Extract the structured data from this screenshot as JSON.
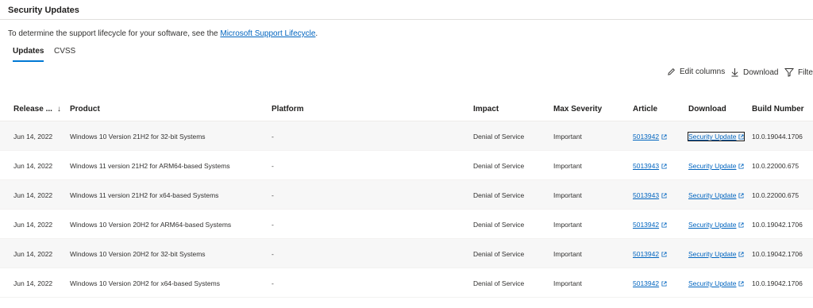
{
  "header": {
    "title": "Security Updates"
  },
  "intro": {
    "text": "To determine the support lifecycle for your software, see the ",
    "link": "Microsoft Support Lifecycle",
    "suffix": "."
  },
  "tabs": [
    {
      "label": "Updates",
      "active": true
    },
    {
      "label": "CVSS",
      "active": false
    }
  ],
  "toolbar": {
    "edit_columns": "Edit columns",
    "download": "Download",
    "filter": "Filter"
  },
  "columns": {
    "release": "Release ...",
    "product": "Product",
    "platform": "Platform",
    "impact": "Impact",
    "max_severity": "Max Severity",
    "article": "Article",
    "download": "Download",
    "build_number": "Build Number"
  },
  "rows": [
    {
      "date": "Jun 14, 2022",
      "product": "Windows 10 Version 21H2 for 32-bit Systems",
      "platform": "-",
      "impact": "Denial of Service",
      "severity": "Important",
      "article": "5013942",
      "download": "Security Update",
      "build": "10.0.19044.1706"
    },
    {
      "date": "Jun 14, 2022",
      "product": "Windows 11 version 21H2 for ARM64-based Systems",
      "platform": "-",
      "impact": "Denial of Service",
      "severity": "Important",
      "article": "5013943",
      "download": "Security Update",
      "build": "10.0.22000.675"
    },
    {
      "date": "Jun 14, 2022",
      "product": "Windows 11 version 21H2 for x64-based Systems",
      "platform": "-",
      "impact": "Denial of Service",
      "severity": "Important",
      "article": "5013943",
      "download": "Security Update",
      "build": "10.0.22000.675"
    },
    {
      "date": "Jun 14, 2022",
      "product": "Windows 10 Version 20H2 for ARM64-based Systems",
      "platform": "-",
      "impact": "Denial of Service",
      "severity": "Important",
      "article": "5013942",
      "download": "Security Update",
      "build": "10.0.19042.1706"
    },
    {
      "date": "Jun 14, 2022",
      "product": "Windows 10 Version 20H2 for 32-bit Systems",
      "platform": "-",
      "impact": "Denial of Service",
      "severity": "Important",
      "article": "5013942",
      "download": "Security Update",
      "build": "10.0.19042.1706"
    },
    {
      "date": "Jun 14, 2022",
      "product": "Windows 10 Version 20H2 for x64-based Systems",
      "platform": "-",
      "impact": "Denial of Service",
      "severity": "Important",
      "article": "5013942",
      "download": "Security Update",
      "build": "10.0.19042.1706"
    }
  ],
  "colors": {
    "accent": "#0078d4",
    "link": "#0064bf",
    "row_alt": "#f7f7f7"
  },
  "icons": {
    "edit": "pencil-icon",
    "download": "download-arrow-icon",
    "filter": "filter-funnel-icon",
    "sort": "sort-down-arrow-icon",
    "external": "external-link-icon"
  }
}
